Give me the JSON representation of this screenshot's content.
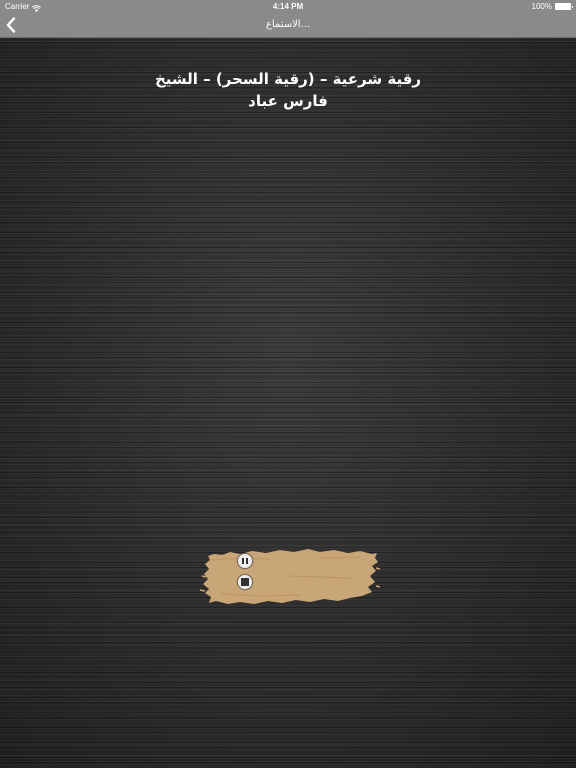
{
  "status_bar": {
    "carrier": "Carrier",
    "time": "4:14 PM",
    "battery": "100%",
    "wifi_icon": "wifi-icon",
    "battery_icon": "battery-icon"
  },
  "nav": {
    "title": "الاستماع...",
    "back_icon": "chevron-left-icon"
  },
  "track": {
    "title_line1": "رقية شرعية – (رقية السحر) – الشيخ",
    "title_line2": "فارس عباد"
  },
  "controls": {
    "pause_icon": "pause-icon",
    "stop_icon": "stop-icon",
    "panel_color": "#c9a677"
  }
}
